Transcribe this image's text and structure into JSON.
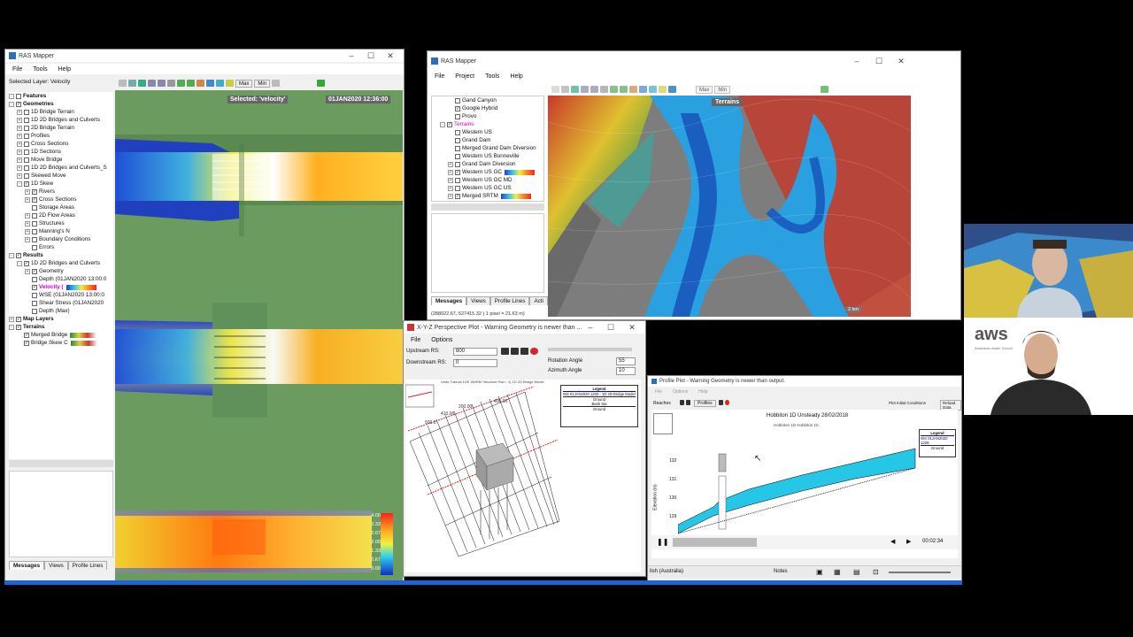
{
  "left_window": {
    "title": "RAS Mapper",
    "menu": [
      "File",
      "Tools",
      "Help"
    ],
    "selected_layer": "Selected Layer: Velocity",
    "toolbar_buttons": [
      "Max",
      "Min"
    ],
    "map_selected_label": "Selected: 'velocity'",
    "map_timestamp": "01JAN2020 12:36:00",
    "tree": [
      {
        "label": "Features",
        "bold": true,
        "indent": 0,
        "exp": "-",
        "cb": ""
      },
      {
        "label": "Geometries",
        "bold": true,
        "indent": 0,
        "exp": "-",
        "cb": "✓"
      },
      {
        "label": "1D Bridge Terrain",
        "indent": 1,
        "exp": "+",
        "cb": ""
      },
      {
        "label": "1D 2D Bridges and Culverts",
        "indent": 1,
        "exp": "+",
        "cb": ""
      },
      {
        "label": "2D Bridge Terrain",
        "indent": 1,
        "exp": "+",
        "cb": ""
      },
      {
        "label": "Profiles",
        "indent": 1,
        "exp": "+",
        "cb": ""
      },
      {
        "label": "Cross Sections",
        "indent": 1,
        "exp": "+",
        "cb": ""
      },
      {
        "label": "1D Sections",
        "indent": 1,
        "exp": "+",
        "cb": ""
      },
      {
        "label": "Move Bridge",
        "indent": 1,
        "exp": "+",
        "cb": ""
      },
      {
        "label": "1D 2D Bridges and Culverts_S",
        "indent": 1,
        "exp": "+",
        "cb": ""
      },
      {
        "label": "Skewed Move",
        "indent": 1,
        "exp": "+",
        "cb": ""
      },
      {
        "label": "1D Skew",
        "indent": 1,
        "exp": "-",
        "cb": "✓"
      },
      {
        "label": "Rivers",
        "indent": 2,
        "exp": "+",
        "cb": "✓"
      },
      {
        "label": "Cross Sections",
        "indent": 2,
        "exp": "+",
        "cb": "✓"
      },
      {
        "label": "Storage Areas",
        "indent": 2,
        "exp": "",
        "cb": ""
      },
      {
        "label": "2D Flow Areas",
        "indent": 2,
        "exp": "+",
        "cb": ""
      },
      {
        "label": "Structures",
        "indent": 2,
        "exp": "+",
        "cb": ""
      },
      {
        "label": "Manning's N",
        "indent": 2,
        "exp": "+",
        "cb": ""
      },
      {
        "label": "Boundary Conditions",
        "indent": 2,
        "exp": "+",
        "cb": ""
      },
      {
        "label": "Errors",
        "indent": 2,
        "exp": "",
        "cb": ""
      },
      {
        "label": "Results",
        "bold": true,
        "indent": 0,
        "exp": "-",
        "cb": "✓"
      },
      {
        "label": "1D 2D Bridges and Culverts",
        "indent": 1,
        "exp": "-",
        "cb": "✓"
      },
      {
        "label": "Geometry",
        "indent": 2,
        "exp": "+",
        "cb": "✓"
      },
      {
        "label": "Depth (01JAN2020 13:00:0",
        "indent": 2,
        "exp": "",
        "cb": ""
      },
      {
        "label": "Velocity (",
        "indent": 2,
        "exp": "",
        "cb": "✓",
        "highlight": true,
        "ramp": true
      },
      {
        "label": "WSE (01JAN2020 13:00:0",
        "indent": 2,
        "exp": "",
        "cb": ""
      },
      {
        "label": "Shear Stress (01JAN2020",
        "indent": 2,
        "exp": "",
        "cb": ""
      },
      {
        "label": "Depth (Max)",
        "indent": 2,
        "exp": "",
        "cb": ""
      },
      {
        "label": "Map Layers",
        "bold": true,
        "indent": 0,
        "exp": "+",
        "cb": "✓"
      },
      {
        "label": "Terrains",
        "bold": true,
        "indent": 0,
        "exp": "-",
        "cb": "✓"
      },
      {
        "label": "Merged Bridge",
        "indent": 1,
        "exp": "",
        "cb": "✓",
        "ramp2": true
      },
      {
        "label": "Bridge Skew C",
        "indent": 1,
        "exp": "",
        "cb": "✓",
        "ramp2": true
      }
    ],
    "tabs": [
      "Messages",
      "Views",
      "Profile Lines"
    ],
    "legend_values": [
      "4.00",
      "3.33",
      "2.67",
      "2.00",
      "1.33",
      "0.67",
      "0.00"
    ]
  },
  "right_window": {
    "title": "RAS Mapper",
    "menu": [
      "File",
      "Project",
      "Tools",
      "Help"
    ],
    "toolbar_buttons": [
      "Max",
      "Min"
    ],
    "tree": [
      {
        "label": "Gand Canyon",
        "indent": 2,
        "cb": ""
      },
      {
        "label": "Google Hybrid",
        "indent": 2,
        "cb": "✓"
      },
      {
        "label": "Provo",
        "indent": 2,
        "cb": ""
      },
      {
        "label": "Terrains",
        "indent": 1,
        "cb": "✓",
        "exp": "-",
        "pink": true
      },
      {
        "label": "Western US",
        "indent": 2,
        "cb": ""
      },
      {
        "label": "Grand Dam",
        "indent": 2,
        "cb": ""
      },
      {
        "label": "Merged Grand Dam Diversion",
        "indent": 2,
        "cb": ""
      },
      {
        "label": "Western US Bonneville",
        "indent": 2,
        "cb": ""
      },
      {
        "label": "Grand Dam Diversion",
        "indent": 2,
        "cb": "",
        "exp": "+"
      },
      {
        "label": "Western US GC",
        "indent": 2,
        "cb": "✓",
        "exp": "+",
        "ramp": true
      },
      {
        "label": "Western US GC MD",
        "indent": 2,
        "cb": "",
        "exp": "+"
      },
      {
        "label": "Western US GC US",
        "indent": 2,
        "cb": "",
        "exp": "+"
      },
      {
        "label": "Merged SRTM",
        "indent": 2,
        "cb": "✓",
        "exp": "+",
        "ramp": true
      }
    ],
    "tabs": [
      "Messages",
      "Views",
      "Profile Lines",
      "Acti"
    ],
    "status": "(288022.67, 527415.32 ) 1 pixel = 21.63 m)",
    "map_label": "Terrains",
    "scale_label": "2 km"
  },
  "xyz_window": {
    "title": "X-Y-Z Perspective Plot - Warning Geometry is newer than ...",
    "menu": [
      "File",
      "Options"
    ],
    "upstream_label": "Upstream RS:",
    "upstream_value": "800",
    "downstream_label": "Downstream RS:",
    "downstream_value": "0",
    "rotation_label": "Rotation Angle",
    "rotation_value": "55",
    "azimuth_label": "Azimuth Angle",
    "azimuth_value": "10",
    "plot_heading": "Unite Tutorial 1DE WARM Structure   Plan : 1) 1D 2D Bridge Model",
    "legend_title": "Legend",
    "legend_items": [
      "WS 01JAN2020 1200 - 1D 2D Bridge Model",
      "Ground",
      "Bank Sta",
      "Ground"
    ],
    "rs_labels": [
      "500.0",
      "410.00",
      "200.00",
      "400.00"
    ]
  },
  "profile_window": {
    "title": "Profile Plot - Warning Geometry is newer than output.",
    "menu": [
      "File",
      "Options",
      "Help"
    ],
    "reaches_label": "Reaches",
    "profiles_label": "Profiles",
    "plot_initial": "Plot Initial Conditions",
    "reload": "Reload Data",
    "plot_title": "Hobbiton 1D Unsteady    28/02/2018",
    "subtitle": "Hobbiton 1D Hobbiton 10",
    "ylabel": "Elevation (m)",
    "y_ticks": [
      "132",
      "131",
      "130",
      "129"
    ],
    "x_ticks": [
      "500",
      "600",
      "700",
      "800"
    ],
    "legend_title": "Legend",
    "legend_items": [
      "WS 01JAN2020 1225",
      "Ground"
    ],
    "timer": "00:02:34"
  },
  "taskbar": {
    "lang": "lish (Australia)",
    "notes": "Notes"
  },
  "webcam": {
    "aws_logo": "aws",
    "aws_sub": "Australian Water School"
  },
  "colors": {
    "accent": "#2a6ebd",
    "water": "#26c6e6",
    "map_green": "#6b9b5e"
  }
}
